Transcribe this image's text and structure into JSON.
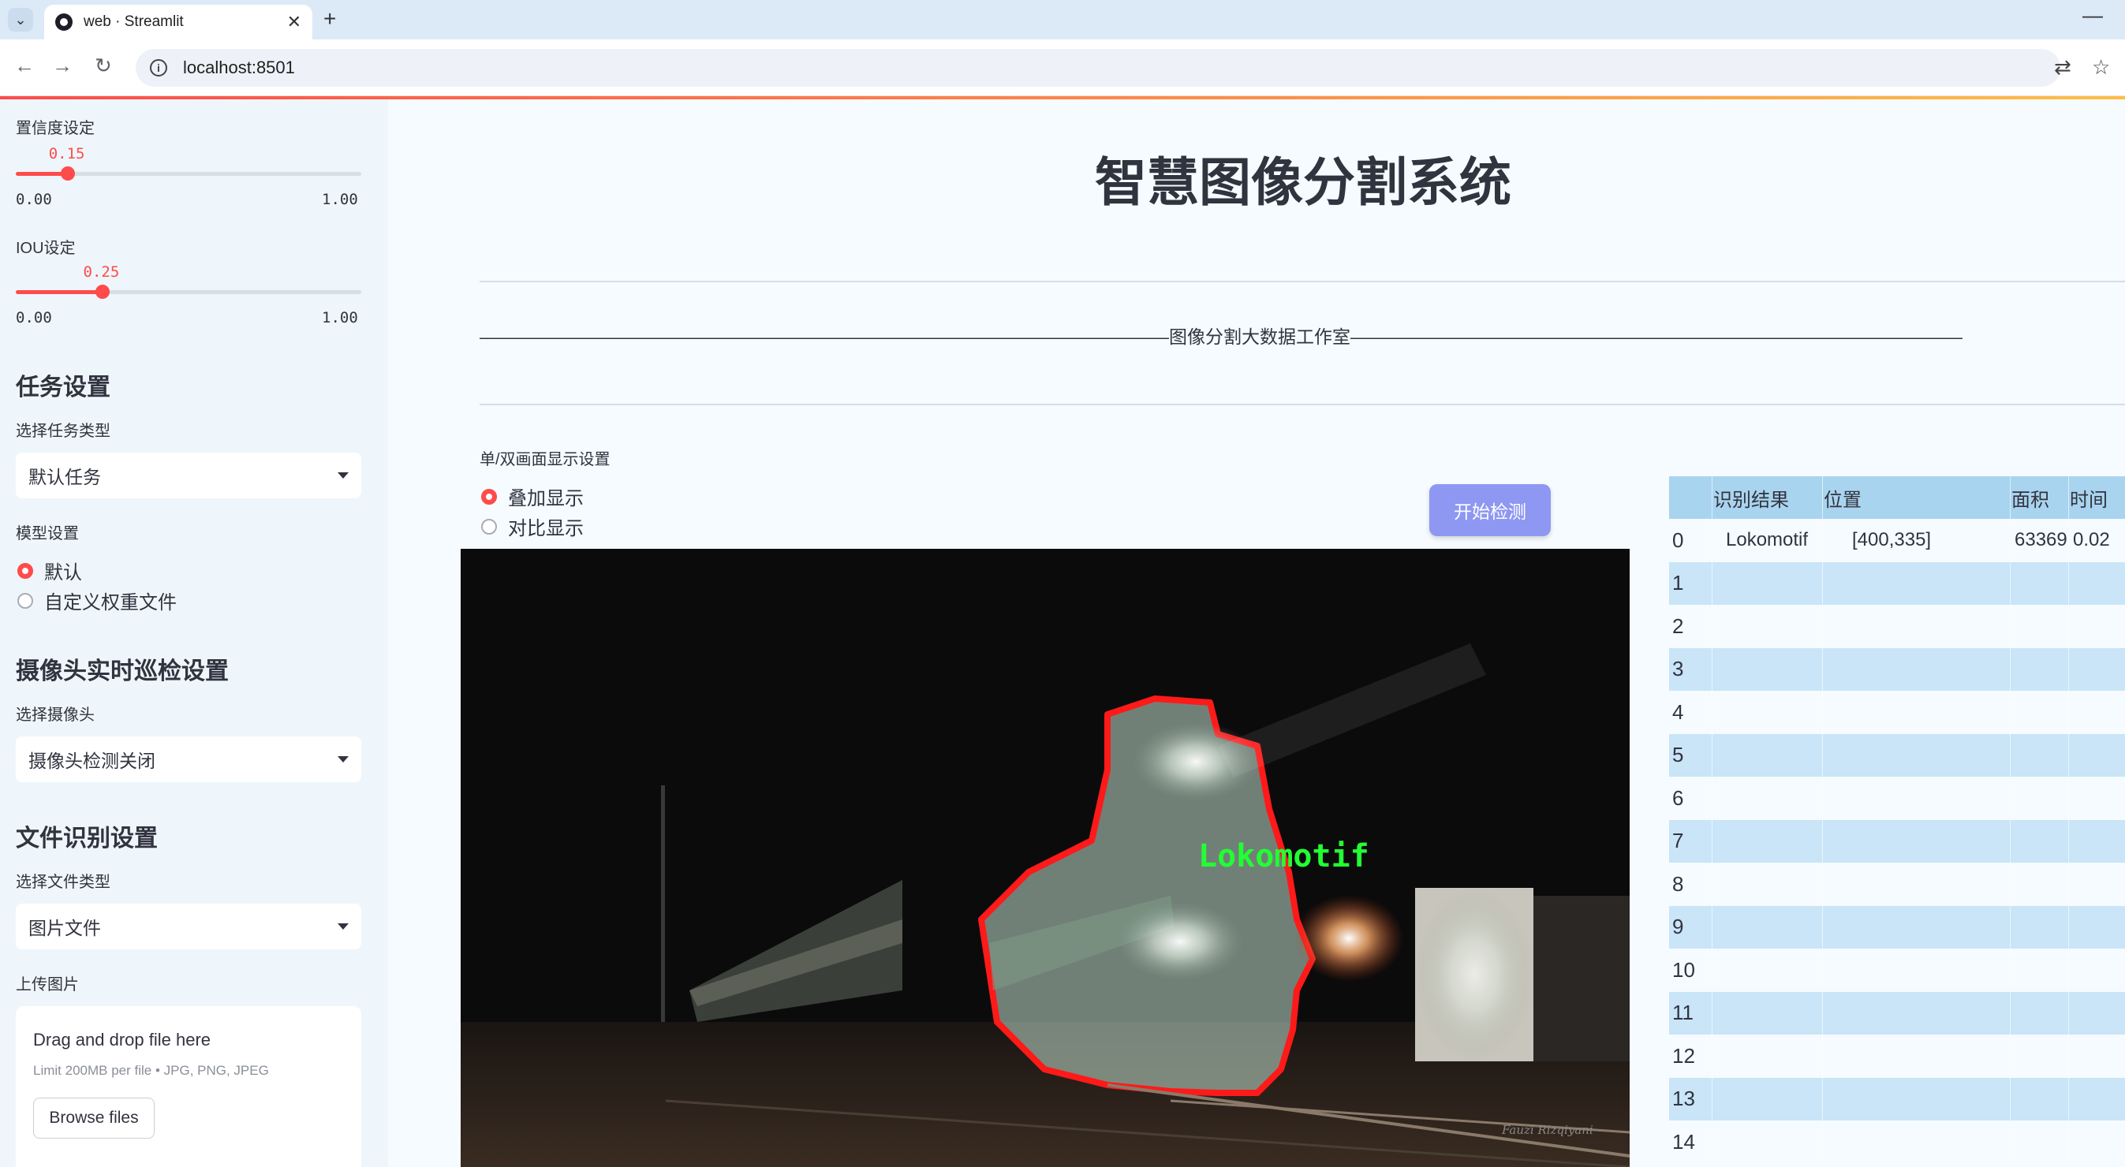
{
  "browser": {
    "tab_title": "web · Streamlit",
    "url": "localhost:8501"
  },
  "sidebar": {
    "confidence": {
      "label": "置信度设定",
      "value": "0.15",
      "min": "0.00",
      "max": "1.00",
      "fraction": 0.15
    },
    "iou": {
      "label": "IOU设定",
      "value": "0.25",
      "min": "0.00",
      "max": "1.00",
      "fraction": 0.25
    },
    "task_section": "任务设置",
    "task_type_label": "选择任务类型",
    "task_type_value": "默认任务",
    "model_label": "模型设置",
    "model_options": [
      "默认",
      "自定义权重文件"
    ],
    "camera_section": "摄像头实时巡检设置",
    "camera_label": "选择摄像头",
    "camera_value": "摄像头检测关闭",
    "file_section": "文件识别设置",
    "file_type_label": "选择文件类型",
    "file_type_value": "图片文件",
    "upload_label": "上传图片",
    "dropzone": {
      "title": "Drag and drop file here",
      "limit": "Limit 200MB per file • JPG, PNG, JPEG",
      "button": "Browse files"
    }
  },
  "main": {
    "title": "智慧图像分割系统",
    "subtitle_line": "——————————————————————————————————————图像分割大数据工作室——————————————————————————————————————",
    "display_label": "单/双画面显示设置",
    "display_options": [
      "叠加显示",
      "对比显示"
    ],
    "start_button": "开始检测",
    "detection_label": "Lokomotif",
    "watermark": "Fauzi Rizqiyani"
  },
  "table": {
    "headers": [
      "识别结果",
      "位置",
      "面积",
      "时间"
    ],
    "rows": [
      {
        "index": "0",
        "result": "Lokomotif",
        "position": "[400,335]",
        "area": "63369",
        "time": "0.02"
      },
      {
        "index": "1"
      },
      {
        "index": "2"
      },
      {
        "index": "3"
      },
      {
        "index": "4"
      },
      {
        "index": "5"
      },
      {
        "index": "6"
      },
      {
        "index": "7"
      },
      {
        "index": "8"
      },
      {
        "index": "9"
      },
      {
        "index": "10"
      },
      {
        "index": "11"
      },
      {
        "index": "12"
      },
      {
        "index": "13"
      },
      {
        "index": "14"
      }
    ]
  },
  "colors": {
    "accent": "#ff4b4b",
    "sidebar_bg": "#eef6fb",
    "button": "#8e98f2",
    "table_header": "#a9d4ef",
    "table_alt": "#c9e5f7",
    "mask_outline": "#ff1a1a",
    "label_green": "#22ff33"
  }
}
